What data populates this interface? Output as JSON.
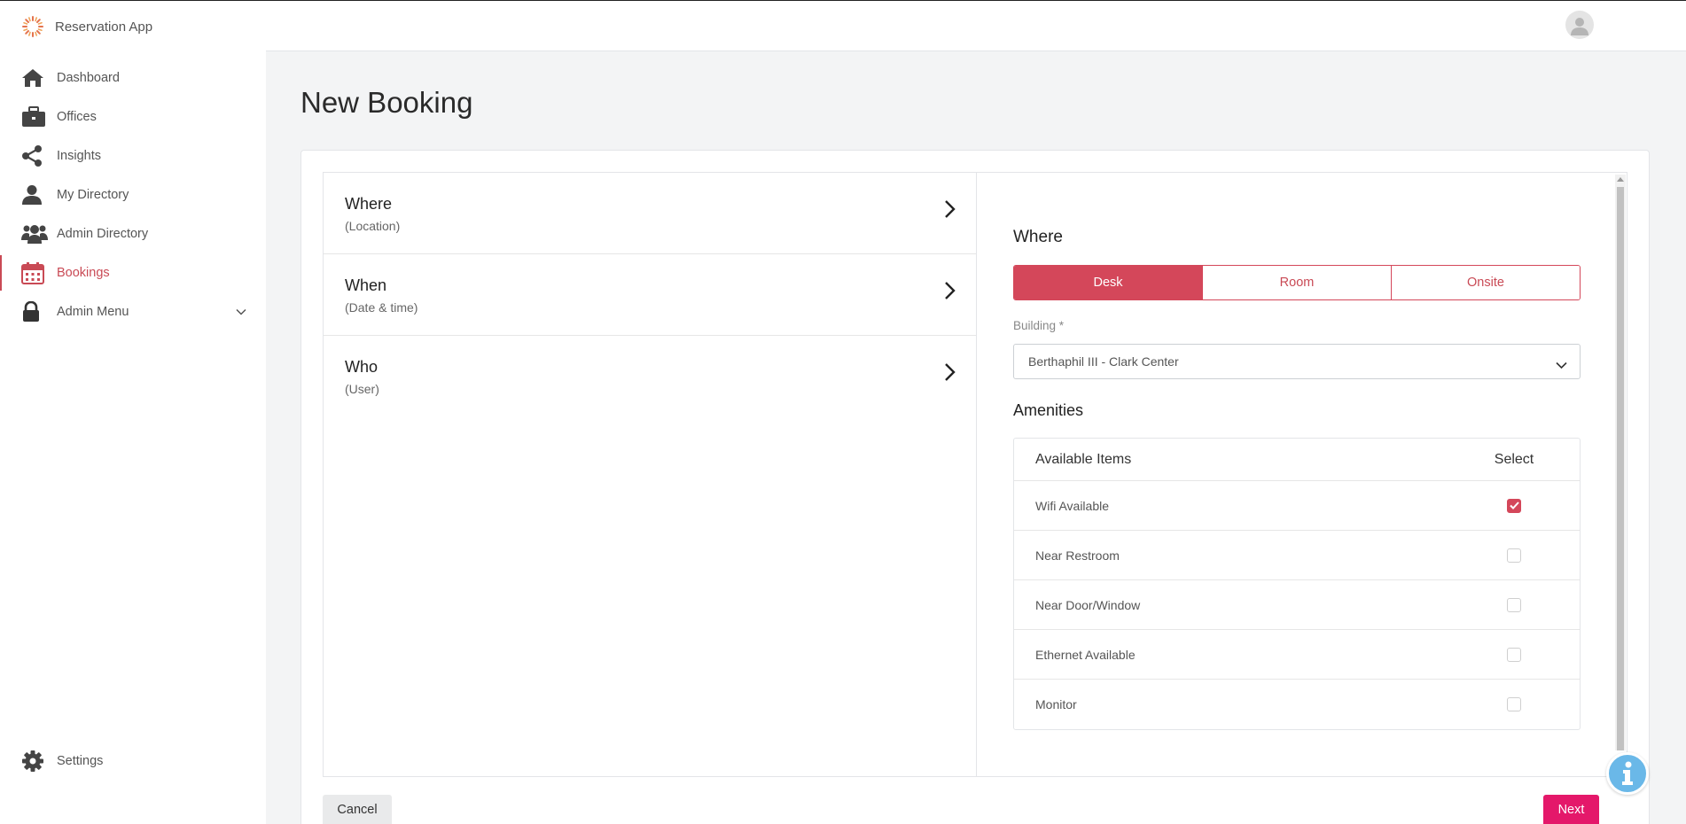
{
  "app": {
    "name": "Reservation App"
  },
  "sidebar": {
    "items": [
      {
        "label": "Dashboard",
        "icon": "home-icon"
      },
      {
        "label": "Offices",
        "icon": "briefcase-icon"
      },
      {
        "label": "Insights",
        "icon": "share-icon"
      },
      {
        "label": "My Directory",
        "icon": "user-icon"
      },
      {
        "label": "Admin Directory",
        "icon": "users-icon"
      },
      {
        "label": "Bookings",
        "icon": "calendar-icon",
        "active": true
      },
      {
        "label": "Admin Menu",
        "icon": "lock-icon",
        "expandable": true
      }
    ],
    "settings": {
      "label": "Settings",
      "icon": "gear-icon"
    }
  },
  "page": {
    "title": "New Booking"
  },
  "steps": [
    {
      "title": "Where",
      "subtitle": "(Location)"
    },
    {
      "title": "When",
      "subtitle": "(Date & time)"
    },
    {
      "title": "Who",
      "subtitle": "(User)"
    }
  ],
  "detail": {
    "title": "Where",
    "types": {
      "options": [
        "Desk",
        "Room",
        "Onsite"
      ],
      "selected": "Desk"
    },
    "building": {
      "label": "Building *",
      "value": "Berthaphil III - Clark Center"
    },
    "amenities": {
      "title": "Amenities",
      "headers": [
        "Available Items",
        "Select"
      ],
      "rows": [
        {
          "label": "Wifi Available",
          "checked": true
        },
        {
          "label": "Near Restroom",
          "checked": false
        },
        {
          "label": "Near Door/Window",
          "checked": false
        },
        {
          "label": "Ethernet Available",
          "checked": false
        },
        {
          "label": "Monitor",
          "checked": false
        }
      ]
    }
  },
  "actions": {
    "cancel_label": "Cancel",
    "next_label": "Next"
  },
  "colors": {
    "accent": "#d4475a",
    "next": "#e4186a",
    "info": "#6ab8e8"
  }
}
